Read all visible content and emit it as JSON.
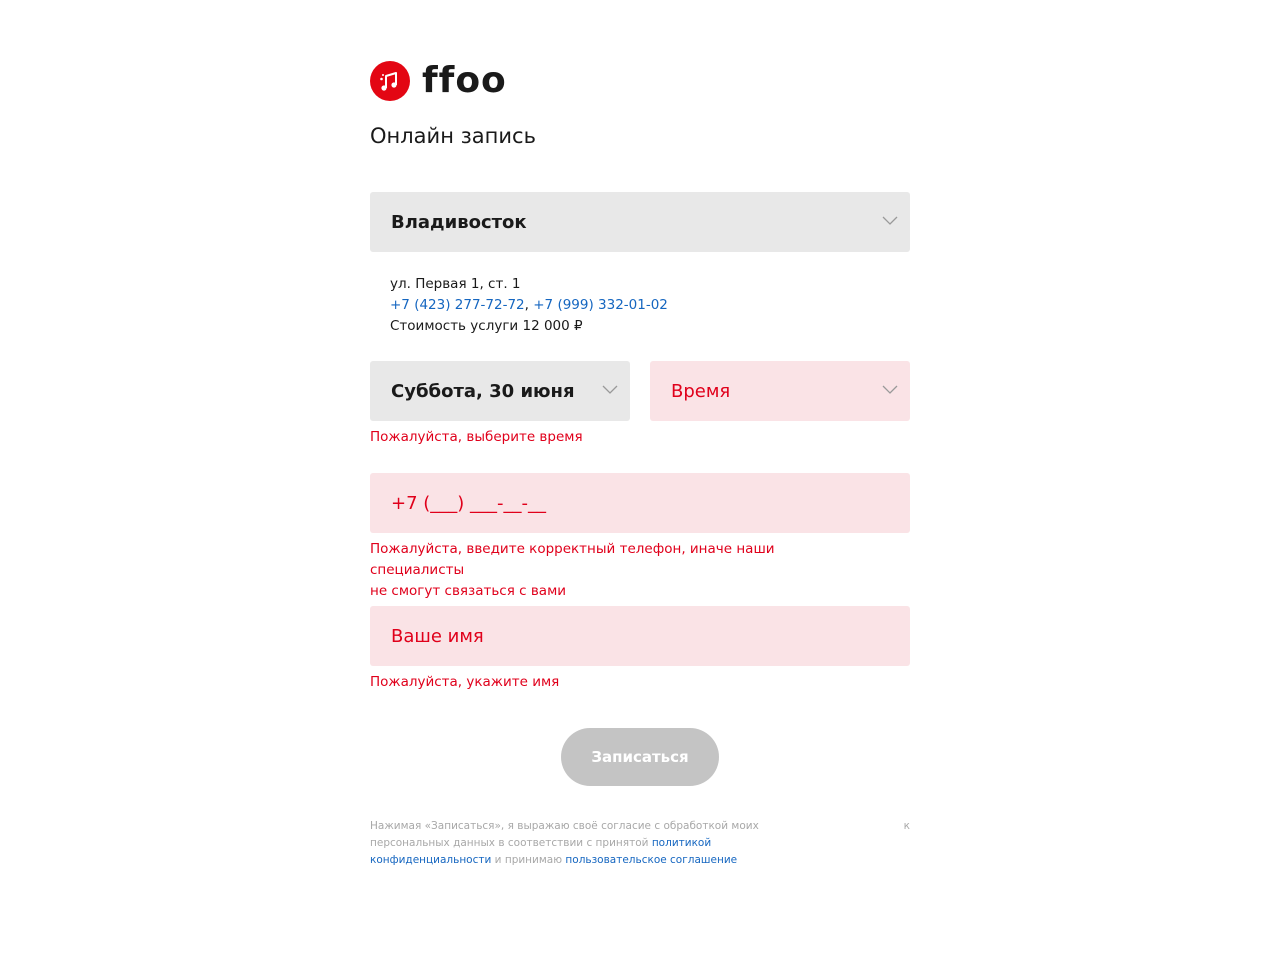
{
  "brand": {
    "name": "ffoo",
    "logo_color": "#e30613"
  },
  "page_title": "Онлайн запись",
  "city_select": {
    "value": "Владивосток"
  },
  "clinic_info": {
    "address": "ул. Первая 1, ст. 1",
    "phone1": "+7 (423) 277-72-72",
    "separator": ", ",
    "phone2": "+7 (999) 332-01-02",
    "price": "Стоимость услуги 12 000 ₽"
  },
  "date_select": {
    "value": "Суббота, 30 июня"
  },
  "time_select": {
    "placeholder": "Время",
    "error": "Пожалуйста, выберите время"
  },
  "phone_input": {
    "placeholder": "+7 (___) ___-__-__",
    "error_line1": "Пожалуйста, введите корректный телефон, иначе наши специалисты",
    "error_line2": "не смогут связаться с вами"
  },
  "name_input": {
    "placeholder": "Ваше имя",
    "error": "Пожалуйста, укажите имя"
  },
  "submit_button": {
    "label": "Записаться"
  },
  "consent": {
    "text1": "Нажимая «Записаться», я выражаю своё согласие с обработкой моих персональных данных в соответствии с принятой ",
    "privacy_link": "политикой конфиденциальности",
    "text2": " и принимаю ",
    "agreement_link": "пользовательское соглашение",
    "trailing": "к"
  },
  "colors": {
    "error": "#e0001b",
    "error_bg": "#fae3e6",
    "neutral_bg": "#e8e8e8",
    "link": "#1566c0",
    "button_disabled": "#c4c4c4"
  }
}
